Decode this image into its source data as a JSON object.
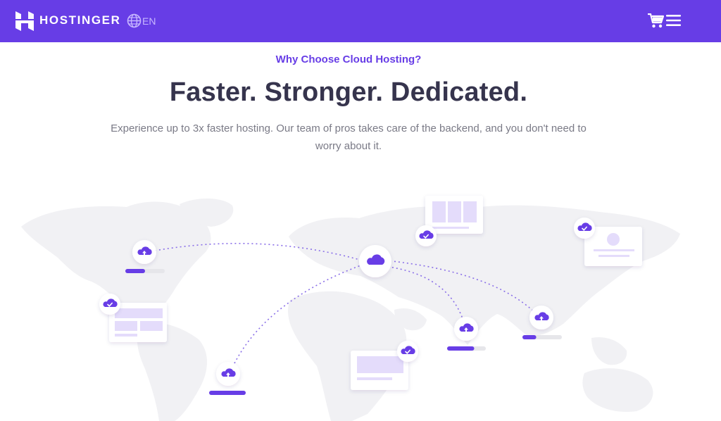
{
  "header": {
    "brand": "HOSTINGER",
    "language": "EN",
    "icons": [
      "hostinger-logo-icon",
      "globe-icon",
      "cart-icon",
      "menu-icon"
    ],
    "background": "#673de6"
  },
  "hero": {
    "eyebrow": "Why Choose Cloud Hosting?",
    "title": "Faster. Stronger. Dedicated.",
    "subtitle": "Experience up to 3x faster hosting. Our team of pros takes care of the backend, and you don't need to worry about it."
  },
  "illustration": {
    "icons": [
      "cloud-icon",
      "upload-icon",
      "check-icon"
    ],
    "progress": {
      "north-america": 0.5,
      "south-america": 1.0,
      "india": 0.7,
      "east-asia": 0.35
    },
    "accent": "#673de6"
  }
}
